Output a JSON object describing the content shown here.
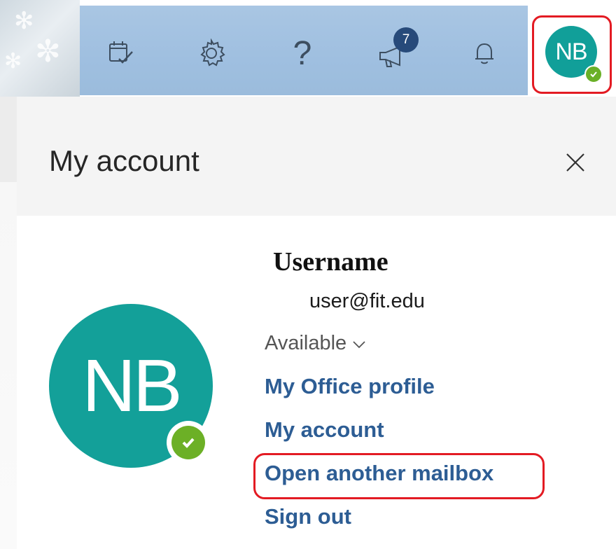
{
  "header": {
    "icons": [
      "calendar-check-icon",
      "gear-icon",
      "help-icon",
      "megaphone-icon",
      "bell-icon"
    ],
    "help_glyph": "?",
    "notifications_badge": "7",
    "avatar_initials": "NB",
    "bar_color": "#a3c2e2"
  },
  "panel": {
    "title": "My account",
    "close_glyph": "×"
  },
  "profile": {
    "initials": "NB",
    "avatar_color": "#13a099",
    "status_color": "#6cb026",
    "username": "Username",
    "email": "user@fit.edu",
    "presence": "Available",
    "presence_chevron": "∨"
  },
  "links": {
    "office_profile": "My Office profile",
    "my_account": "My account",
    "open_mailbox": "Open another mailbox",
    "sign_out": "Sign out",
    "link_color": "#2d5d94"
  },
  "annotations": {
    "highlight_color": "#e31b23"
  }
}
